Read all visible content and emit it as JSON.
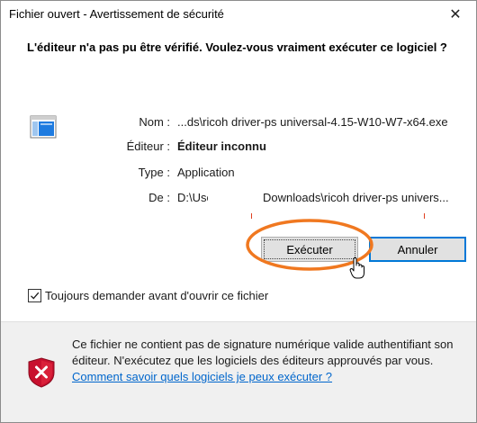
{
  "dialog": {
    "title": "Fichier ouvert - Avertissement de sécurité",
    "close_symbol": "✕",
    "heading": "L'éditeur n'a pas pu être vérifié. Voulez-vous vraiment exécuter ce logiciel ?",
    "app_icon": "application-window-icon",
    "fields": {
      "name_label": "Nom :",
      "name_value": "...ds\\ricoh driver-ps universal-4.15-W10-W7-x64.exe",
      "publisher_label": "Éditeur :",
      "publisher_value": "Éditeur inconnu",
      "type_label": "Type :",
      "type_value": "Application",
      "from_label": "De :",
      "from_value_prefix": "D:\\Users\\",
      "from_value_suffix": "Downloads\\ricoh driver-ps univers..."
    },
    "buttons": {
      "run_label": "Exécuter",
      "cancel_label": "Annuler"
    },
    "checkbox": {
      "label": "Toujours demander avant d'ouvrir ce fichier",
      "checked": true
    },
    "footer": {
      "icon": "shield-warning-icon",
      "text": "Ce fichier ne contient pas de signature numérique valide authentifiant son éditeur. N'exécutez que les logiciels des éditeurs approuvés par vous.",
      "link": "Comment savoir quels logiciels je peux exécuter ?"
    },
    "colors": {
      "accent": "#0078d7",
      "highlight": "#f07820",
      "link": "#0066cc",
      "shield": "#c8102e"
    }
  }
}
